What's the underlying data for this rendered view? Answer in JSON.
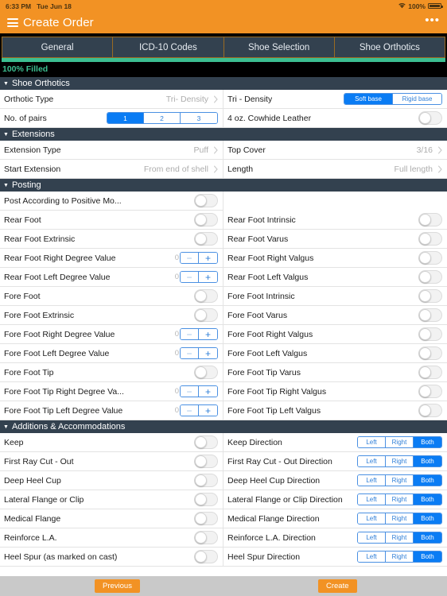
{
  "status_bar": {
    "time": "6:33 PM",
    "date": "Tue Jun 18",
    "battery_pct": "100%",
    "wifi_icon": "wifi-icon",
    "battery_icon": "battery-icon"
  },
  "header": {
    "title": "Create Order",
    "menu_icon": "hamburger-menu-icon",
    "overflow_icon": "more-options-icon"
  },
  "tabs": [
    {
      "label": "General",
      "active": false
    },
    {
      "label": "ICD-10 Codes",
      "active": false
    },
    {
      "label": "Shoe Selection",
      "active": false
    },
    {
      "label": "Shoe Orthotics",
      "active": true
    }
  ],
  "progress": {
    "percent": 100,
    "label": "100% Filled",
    "color": "#3cbf91"
  },
  "sections": [
    {
      "title": "Shoe Orthotics",
      "rows": [
        {
          "left": {
            "label": "Orthotic Type",
            "type": "select",
            "value": "Tri- Density"
          },
          "right": {
            "label": "Tri - Density",
            "type": "segmented",
            "options": [
              "Soft base",
              "Rigid base"
            ],
            "selected": "Soft base"
          }
        },
        {
          "left": {
            "label": "No. of pairs",
            "type": "segmented",
            "options": [
              "1",
              "2",
              "3"
            ],
            "selected": "1"
          },
          "right": {
            "label": "4 oz. Cowhide Leather",
            "type": "toggle",
            "value": false
          }
        }
      ]
    },
    {
      "title": "Extensions",
      "rows": [
        {
          "left": {
            "label": "Extension Type",
            "type": "select",
            "value": "Puff"
          },
          "right": {
            "label": "Top Cover",
            "type": "select",
            "value": "3/16"
          }
        },
        {
          "left": {
            "label": "Start Extension",
            "type": "select",
            "value": "From end of shell"
          },
          "right": {
            "label": "Length",
            "type": "select",
            "value": "Full length"
          }
        }
      ]
    },
    {
      "title": "Posting",
      "rows": [
        {
          "left": {
            "label": "Post According to Positive Mo...",
            "type": "toggle",
            "value": false
          },
          "right": {
            "label": "",
            "type": "empty"
          }
        },
        {
          "left": {
            "label": "Rear Foot",
            "type": "toggle",
            "value": false
          },
          "right": {
            "label": "Rear Foot Intrinsic",
            "type": "toggle",
            "value": false
          }
        },
        {
          "left": {
            "label": "Rear Foot Extrinsic",
            "type": "toggle",
            "value": false
          },
          "right": {
            "label": "Rear Foot Varus",
            "type": "toggle",
            "value": false
          }
        },
        {
          "left": {
            "label": "Rear Foot Right Degree Value",
            "type": "stepper",
            "value": "0"
          },
          "right": {
            "label": "Rear Foot Right Valgus",
            "type": "toggle",
            "value": false
          }
        },
        {
          "left": {
            "label": "Rear Foot Left Degree Value",
            "type": "stepper",
            "value": "0"
          },
          "right": {
            "label": "Rear Foot Left Valgus",
            "type": "toggle",
            "value": false
          }
        },
        {
          "left": {
            "label": "Fore Foot",
            "type": "toggle",
            "value": false
          },
          "right": {
            "label": "Fore Foot Intrinsic",
            "type": "toggle",
            "value": false
          }
        },
        {
          "left": {
            "label": "Fore Foot Extrinsic",
            "type": "toggle",
            "value": false
          },
          "right": {
            "label": "Fore Foot Varus",
            "type": "toggle",
            "value": false
          }
        },
        {
          "left": {
            "label": "Fore Foot Right Degree Value",
            "type": "stepper",
            "value": "0"
          },
          "right": {
            "label": "Fore Foot Right Valgus",
            "type": "toggle",
            "value": false
          }
        },
        {
          "left": {
            "label": "Fore Foot Left Degree Value",
            "type": "stepper",
            "value": "0"
          },
          "right": {
            "label": "Fore Foot Left Valgus",
            "type": "toggle",
            "value": false
          }
        },
        {
          "left": {
            "label": "Fore Foot Tip",
            "type": "toggle",
            "value": false
          },
          "right": {
            "label": "Fore Foot Tip Varus",
            "type": "toggle",
            "value": false
          }
        },
        {
          "left": {
            "label": "Fore Foot Tip Right Degree Va...",
            "type": "stepper",
            "value": "0"
          },
          "right": {
            "label": "Fore Foot Tip Right Valgus",
            "type": "toggle",
            "value": false
          }
        },
        {
          "left": {
            "label": "Fore Foot Tip Left Degree Value",
            "type": "stepper",
            "value": "0"
          },
          "right": {
            "label": "Fore Foot Tip Left Valgus",
            "type": "toggle",
            "value": false
          }
        }
      ]
    },
    {
      "title": "Additions & Accommodations",
      "rows": [
        {
          "left": {
            "label": "Keep",
            "type": "toggle",
            "value": false
          },
          "right": {
            "label": "Keep Direction",
            "type": "segmented",
            "options": [
              "Left",
              "Right",
              "Both"
            ],
            "selected": "Both"
          }
        },
        {
          "left": {
            "label": "First Ray Cut - Out",
            "type": "toggle",
            "value": false
          },
          "right": {
            "label": "First Ray Cut - Out Direction",
            "type": "segmented",
            "options": [
              "Left",
              "Right",
              "Both"
            ],
            "selected": "Both"
          }
        },
        {
          "left": {
            "label": "Deep Heel Cup",
            "type": "toggle",
            "value": false
          },
          "right": {
            "label": "Deep Heel Cup Direction",
            "type": "segmented",
            "options": [
              "Left",
              "Right",
              "Both"
            ],
            "selected": "Both"
          }
        },
        {
          "left": {
            "label": "Lateral Flange or Clip",
            "type": "toggle",
            "value": false
          },
          "right": {
            "label": "Lateral Flange or Clip Direction",
            "type": "segmented",
            "options": [
              "Left",
              "Right",
              "Both"
            ],
            "selected": "Both"
          }
        },
        {
          "left": {
            "label": "Medical Flange",
            "type": "toggle",
            "value": false
          },
          "right": {
            "label": "Medical Flange Direction",
            "type": "segmented",
            "options": [
              "Left",
              "Right",
              "Both"
            ],
            "selected": "Both"
          }
        },
        {
          "left": {
            "label": "Reinforce L.A.",
            "type": "toggle",
            "value": false
          },
          "right": {
            "label": "Reinforce L.A. Direction",
            "type": "segmented",
            "options": [
              "Left",
              "Right",
              "Both"
            ],
            "selected": "Both"
          }
        },
        {
          "left": {
            "label": "Heel Spur (as marked on cast)",
            "type": "toggle",
            "value": false
          },
          "right": {
            "label": "Heel Spur Direction",
            "type": "segmented",
            "options": [
              "Left",
              "Right",
              "Both"
            ],
            "selected": "Both"
          }
        }
      ]
    }
  ],
  "footer": {
    "previous_label": "Previous",
    "create_label": "Create",
    "accent": "#F29224"
  }
}
